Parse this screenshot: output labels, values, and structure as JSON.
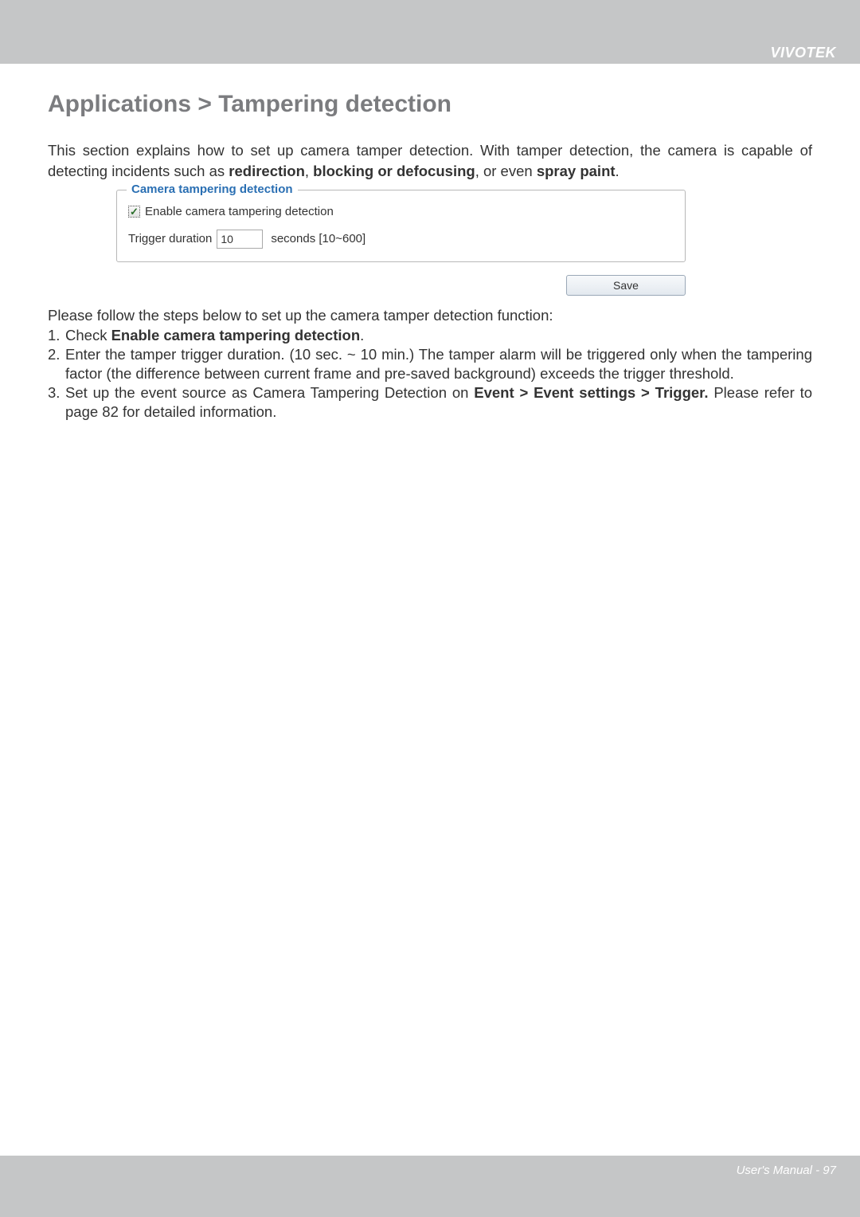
{
  "header": {
    "brand": "VIVOTEK"
  },
  "page": {
    "title": "Applications > Tampering detection",
    "intro_pre": "This section explains how to set up camera tamper detection. With tamper detection, the camera is capable of detecting incidents such as ",
    "intro_bold1": "redirection",
    "intro_sep1": ", ",
    "intro_bold2": "blocking or defocusing",
    "intro_sep2": ", or even ",
    "intro_bold3": "spray paint",
    "intro_post": "."
  },
  "figure": {
    "legend": "Camera tampering detection",
    "checkbox_label": "Enable camera tampering detection",
    "checkbox_checked": true,
    "trigger_label": "Trigger duration",
    "trigger_value": "10",
    "trigger_suffix": "seconds [10~600]",
    "save_label": "Save"
  },
  "instructions": {
    "lead": "Please follow the steps below to set up the camera tamper detection function:",
    "item1_num": "1.",
    "item1_pre": "Check ",
    "item1_bold": "Enable camera tampering detection",
    "item1_post": ".",
    "item2_num": "2.",
    "item2_text": "Enter the tamper trigger duration. (10 sec. ~ 10 min.) The tamper alarm will be triggered only when the tampering factor (the difference between current frame and pre-saved background) exceeds the trigger threshold.",
    "item3_num": "3.",
    "item3_pre": "Set up the event source as Camera Tampering Detection on ",
    "item3_bold": "Event > Event settings > Trigger.",
    "item3_post": " Please refer to page 82 for detailed information."
  },
  "footer": {
    "text": "User's Manual - 97"
  }
}
